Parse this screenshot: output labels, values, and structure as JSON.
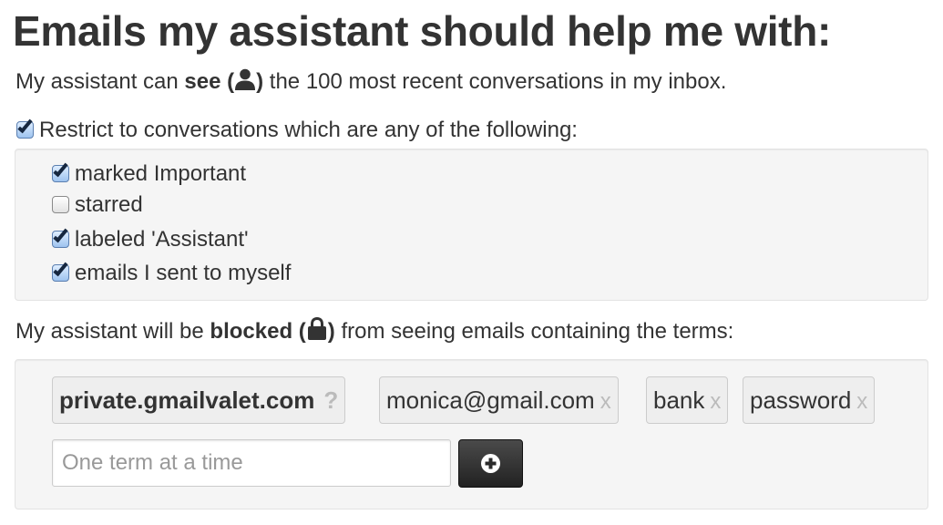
{
  "heading": "Emails my assistant should help me with:",
  "see_line": {
    "prefix": "My assistant can ",
    "bold_word": "see",
    "open_paren": " (",
    "icon": "person-icon",
    "close_paren": ")",
    "suffix": " the 100 most recent conversations in my inbox."
  },
  "restrict": {
    "label": "Restrict to conversations which are any of the following:",
    "checked": true,
    "options": [
      {
        "label": "marked Important",
        "checked": true
      },
      {
        "label": "starred",
        "checked": false
      },
      {
        "label": "labeled 'Assistant'",
        "checked": true
      },
      {
        "label": "emails I sent to myself",
        "checked": true
      }
    ]
  },
  "blocked_line": {
    "prefix": "My assistant will be ",
    "bold_word": "blocked",
    "open_paren": " (",
    "icon": "lock-icon",
    "close_paren": ")",
    "suffix": " from seeing emails containing the terms:"
  },
  "terms": {
    "domain_tag": {
      "label": "private.gmailvalet.com",
      "help": "?"
    },
    "tags": [
      {
        "label": "monica@gmail.com",
        "remove": "x"
      },
      {
        "label": "bank",
        "remove": "x"
      },
      {
        "label": "password",
        "remove": "x"
      }
    ],
    "input_placeholder": "One term at a time",
    "add_button_icon": "plus-circle-icon"
  },
  "colors": {
    "text": "#333333",
    "well_bg": "#f5f5f5",
    "tag_bg": "#eeeeee",
    "checkbox_checked": "#9ec3ef",
    "button_dark": "#222222"
  }
}
